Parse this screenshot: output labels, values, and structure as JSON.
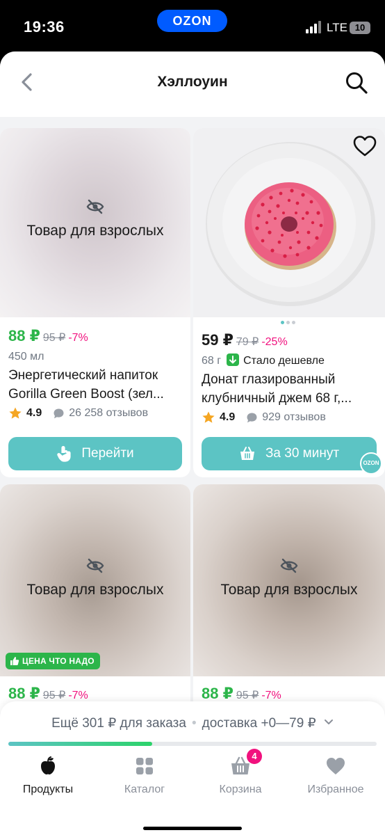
{
  "status_bar": {
    "time": "19:36",
    "brand": "OZON",
    "network": "LTE",
    "battery": "10"
  },
  "header": {
    "title": "Хэллоуин"
  },
  "products": [
    {
      "adult_label": "Товар для взрослых",
      "price": "88 ₽",
      "old_price": "95 ₽",
      "discount": "-7%",
      "volume": "450 мл",
      "name": "Энергетический напиток Gorilla Green Boost (зел...",
      "rating": "4.9",
      "reviews": "26 258 отзывов",
      "button_label": "Перейти"
    },
    {
      "price": "59 ₽",
      "old_price": "79 ₽",
      "discount": "-25%",
      "weight": "68 г",
      "cheaper_label": "Стало дешевле",
      "name": "Донат глазированный клубничный джем 68 г,...",
      "rating": "4.9",
      "reviews": "929 отзывов",
      "button_label": "За 30 минут",
      "ozon_mark": "OZON"
    },
    {
      "adult_label": "Товар для взрослых",
      "badge": "ЦЕНА ЧТО НАДО",
      "price": "88 ₽",
      "old_price": "95 ₽",
      "discount": "-7%"
    },
    {
      "adult_label": "Товар для взрослых",
      "price": "88 ₽",
      "old_price": "95 ₽",
      "discount": "-7%"
    }
  ],
  "delivery_bar": {
    "order_hint": "Ещё 301 ₽ для заказа",
    "delivery_hint": "доставка +0—79 ₽",
    "progress_fraction": 0.39
  },
  "bottom_nav": [
    {
      "label": "Продукты",
      "icon": "apple-icon",
      "active": true
    },
    {
      "label": "Каталог",
      "icon": "grid-icon"
    },
    {
      "label": "Корзина",
      "icon": "basket-icon",
      "badge": "4"
    },
    {
      "label": "Избранное",
      "icon": "heart-icon"
    }
  ],
  "colors": {
    "accent": "#5cc4c4",
    "price_green": "#2cb54a",
    "discount_pink": "#f1117e",
    "ozon_blue": "#005bff"
  }
}
